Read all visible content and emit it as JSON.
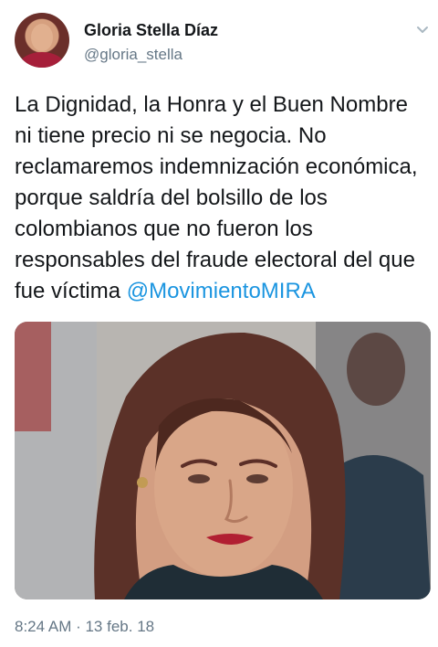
{
  "tweet": {
    "author_name": "Gloria Stella Díaz",
    "author_handle": "@gloria_stella",
    "text_before_mention": "La Dignidad, la Honra y el Buen Nombre ni tiene precio ni se negocia. No reclamaremos indemnización económica, porque saldría del bolsillo de los colombianos que no fueron los responsables del fraude electoral del que fue víctima ",
    "mention": "@MovimientoMIRA",
    "timestamp": "8:24 AM · 13 feb. 18"
  },
  "icons": {
    "avatar": "profile-avatar",
    "menu": "chevron-down-icon"
  },
  "colors": {
    "text": "#14171a",
    "secondary_text": "#657786",
    "link": "#1b95e0",
    "background": "#ffffff"
  }
}
